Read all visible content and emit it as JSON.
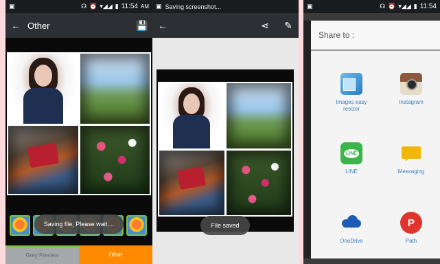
{
  "panel1": {
    "status": {
      "time": "11:54",
      "ampm": "AM"
    },
    "actionbar": {
      "title": "Other"
    },
    "toast": "Saving file, Please wait....",
    "buttons": {
      "left": "Grey Preview",
      "right": "Other"
    },
    "accent_green": "#7cc142",
    "accent_orange": "#ff8a00"
  },
  "panel2": {
    "status": {
      "notification": "Saving screenshot..."
    },
    "toast": "File saved"
  },
  "panel3": {
    "status": {
      "time": "11:54"
    },
    "dialog": {
      "title": "Share to :",
      "apps": [
        {
          "label_line1": "Images easy",
          "label_line2": "resizer",
          "icon": "images-easy-resizer-icon"
        },
        {
          "label_line1": "Instagram",
          "label_line2": "",
          "icon": "instagram-icon"
        },
        {
          "label_line1": "LINE",
          "label_line2": "",
          "icon": "line-icon"
        },
        {
          "label_line1": "Messaging",
          "label_line2": "",
          "icon": "messaging-icon"
        },
        {
          "label_line1": "OneDrive",
          "label_line2": "",
          "icon": "onedrive-icon"
        },
        {
          "label_line1": "Path",
          "label_line2": "",
          "icon": "path-icon"
        }
      ]
    },
    "line_icon_text": "LINE",
    "path_icon_text": "P"
  }
}
